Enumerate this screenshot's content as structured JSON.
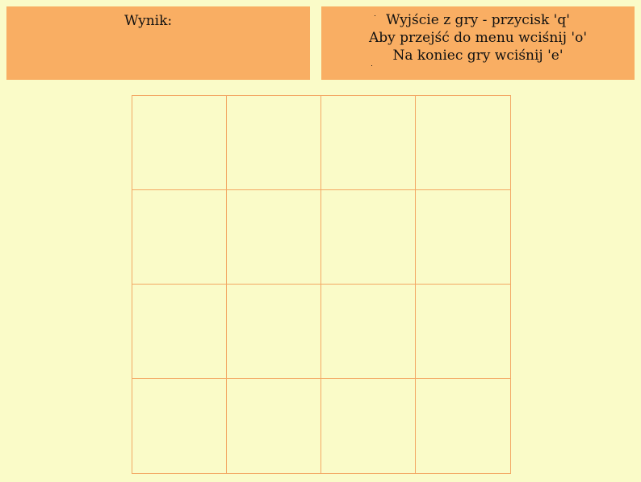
{
  "score_panel": {
    "label": "Wynik:"
  },
  "info_panel": {
    "lines": [
      "Wyjście z gry - przycisk 'q'",
      "Aby przejść do menu wciśnij 'o'",
      "Na koniec gry wciśnij 'e'"
    ]
  },
  "board": {
    "rows": 4,
    "cols": 4,
    "cells": [
      [
        "",
        "",
        "",
        ""
      ],
      [
        "",
        "",
        "",
        ""
      ],
      [
        "",
        "",
        "",
        ""
      ],
      [
        "",
        "",
        "",
        ""
      ]
    ]
  },
  "colors": {
    "background": "#fafbc8",
    "panel": "#f9ae63",
    "grid_line": "#f3a864",
    "text": "#111111"
  }
}
